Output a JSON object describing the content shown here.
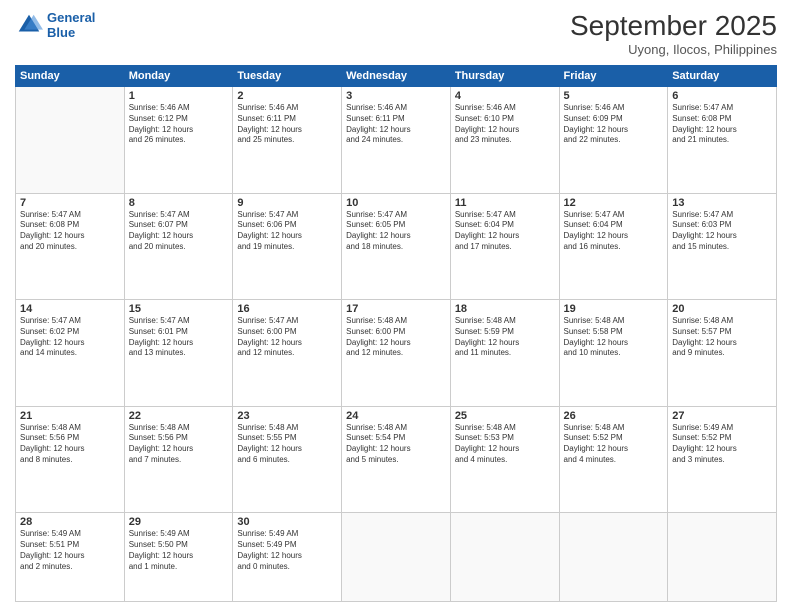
{
  "header": {
    "logo_line1": "General",
    "logo_line2": "Blue",
    "month": "September 2025",
    "location": "Uyong, Ilocos, Philippines"
  },
  "weekdays": [
    "Sunday",
    "Monday",
    "Tuesday",
    "Wednesday",
    "Thursday",
    "Friday",
    "Saturday"
  ],
  "weeks": [
    [
      {
        "day": "",
        "text": ""
      },
      {
        "day": "1",
        "text": "Sunrise: 5:46 AM\nSunset: 6:12 PM\nDaylight: 12 hours\nand 26 minutes."
      },
      {
        "day": "2",
        "text": "Sunrise: 5:46 AM\nSunset: 6:11 PM\nDaylight: 12 hours\nand 25 minutes."
      },
      {
        "day": "3",
        "text": "Sunrise: 5:46 AM\nSunset: 6:11 PM\nDaylight: 12 hours\nand 24 minutes."
      },
      {
        "day": "4",
        "text": "Sunrise: 5:46 AM\nSunset: 6:10 PM\nDaylight: 12 hours\nand 23 minutes."
      },
      {
        "day": "5",
        "text": "Sunrise: 5:46 AM\nSunset: 6:09 PM\nDaylight: 12 hours\nand 22 minutes."
      },
      {
        "day": "6",
        "text": "Sunrise: 5:47 AM\nSunset: 6:08 PM\nDaylight: 12 hours\nand 21 minutes."
      }
    ],
    [
      {
        "day": "7",
        "text": "Sunrise: 5:47 AM\nSunset: 6:08 PM\nDaylight: 12 hours\nand 20 minutes."
      },
      {
        "day": "8",
        "text": "Sunrise: 5:47 AM\nSunset: 6:07 PM\nDaylight: 12 hours\nand 20 minutes."
      },
      {
        "day": "9",
        "text": "Sunrise: 5:47 AM\nSunset: 6:06 PM\nDaylight: 12 hours\nand 19 minutes."
      },
      {
        "day": "10",
        "text": "Sunrise: 5:47 AM\nSunset: 6:05 PM\nDaylight: 12 hours\nand 18 minutes."
      },
      {
        "day": "11",
        "text": "Sunrise: 5:47 AM\nSunset: 6:04 PM\nDaylight: 12 hours\nand 17 minutes."
      },
      {
        "day": "12",
        "text": "Sunrise: 5:47 AM\nSunset: 6:04 PM\nDaylight: 12 hours\nand 16 minutes."
      },
      {
        "day": "13",
        "text": "Sunrise: 5:47 AM\nSunset: 6:03 PM\nDaylight: 12 hours\nand 15 minutes."
      }
    ],
    [
      {
        "day": "14",
        "text": "Sunrise: 5:47 AM\nSunset: 6:02 PM\nDaylight: 12 hours\nand 14 minutes."
      },
      {
        "day": "15",
        "text": "Sunrise: 5:47 AM\nSunset: 6:01 PM\nDaylight: 12 hours\nand 13 minutes."
      },
      {
        "day": "16",
        "text": "Sunrise: 5:47 AM\nSunset: 6:00 PM\nDaylight: 12 hours\nand 12 minutes."
      },
      {
        "day": "17",
        "text": "Sunrise: 5:48 AM\nSunset: 6:00 PM\nDaylight: 12 hours\nand 12 minutes."
      },
      {
        "day": "18",
        "text": "Sunrise: 5:48 AM\nSunset: 5:59 PM\nDaylight: 12 hours\nand 11 minutes."
      },
      {
        "day": "19",
        "text": "Sunrise: 5:48 AM\nSunset: 5:58 PM\nDaylight: 12 hours\nand 10 minutes."
      },
      {
        "day": "20",
        "text": "Sunrise: 5:48 AM\nSunset: 5:57 PM\nDaylight: 12 hours\nand 9 minutes."
      }
    ],
    [
      {
        "day": "21",
        "text": "Sunrise: 5:48 AM\nSunset: 5:56 PM\nDaylight: 12 hours\nand 8 minutes."
      },
      {
        "day": "22",
        "text": "Sunrise: 5:48 AM\nSunset: 5:56 PM\nDaylight: 12 hours\nand 7 minutes."
      },
      {
        "day": "23",
        "text": "Sunrise: 5:48 AM\nSunset: 5:55 PM\nDaylight: 12 hours\nand 6 minutes."
      },
      {
        "day": "24",
        "text": "Sunrise: 5:48 AM\nSunset: 5:54 PM\nDaylight: 12 hours\nand 5 minutes."
      },
      {
        "day": "25",
        "text": "Sunrise: 5:48 AM\nSunset: 5:53 PM\nDaylight: 12 hours\nand 4 minutes."
      },
      {
        "day": "26",
        "text": "Sunrise: 5:48 AM\nSunset: 5:52 PM\nDaylight: 12 hours\nand 4 minutes."
      },
      {
        "day": "27",
        "text": "Sunrise: 5:49 AM\nSunset: 5:52 PM\nDaylight: 12 hours\nand 3 minutes."
      }
    ],
    [
      {
        "day": "28",
        "text": "Sunrise: 5:49 AM\nSunset: 5:51 PM\nDaylight: 12 hours\nand 2 minutes."
      },
      {
        "day": "29",
        "text": "Sunrise: 5:49 AM\nSunset: 5:50 PM\nDaylight: 12 hours\nand 1 minute."
      },
      {
        "day": "30",
        "text": "Sunrise: 5:49 AM\nSunset: 5:49 PM\nDaylight: 12 hours\nand 0 minutes."
      },
      {
        "day": "",
        "text": ""
      },
      {
        "day": "",
        "text": ""
      },
      {
        "day": "",
        "text": ""
      },
      {
        "day": "",
        "text": ""
      }
    ]
  ]
}
